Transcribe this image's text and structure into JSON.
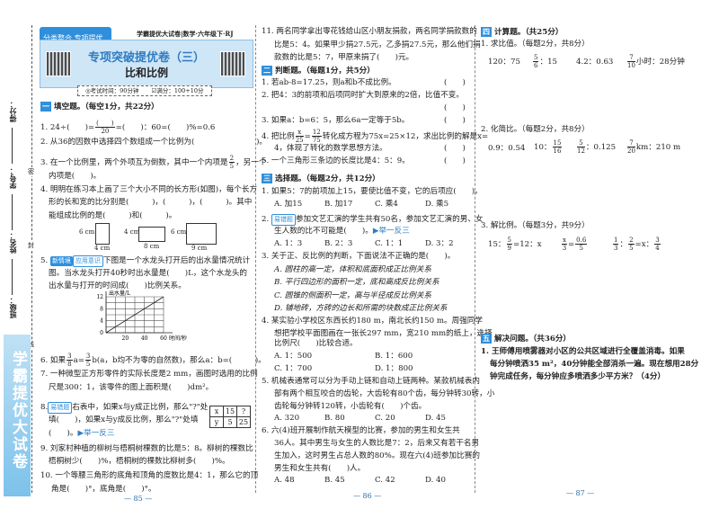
{
  "margin": {
    "labels": [
      "得分：",
      "学号：",
      "姓名：",
      "班级："
    ],
    "seal": [
      "密",
      "封",
      "线"
    ],
    "banner": "学霸提优大试卷"
  },
  "header": {
    "category_tag": "分类整合 专项提优",
    "series": "学霸提优大试卷|数学·六年级下·RJ",
    "title": "专项突破提优卷（三）",
    "subtitle": "比和比例",
    "time": "◎考试时间：90分钟",
    "score": "☑满分：100+10分"
  },
  "section1": {
    "heading_num": "一",
    "heading": "填空题。（每空1分，共22分）",
    "q1": {
      "a": "1. 24÷(　　)=",
      "num": "(　　)",
      "den": "20",
      "b": "=(　　)：60=(　　)%=0.6"
    },
    "q2": "2. 从36的因数中选择四个数组成一个比例为(　　　　　　　　)。",
    "q3": {
      "a": "3. 在一个比例里，两个外项互为倒数，其中一个内项是",
      "num": "2",
      "den": "5",
      "b": "，另一个",
      "c": "内项是(　　)。"
    },
    "q4": [
      "4. 明明在练习本上画了三个大小不同的长方形(如图)，每个长方",
      "形的长和宽的比分别是(　　　)，(　　　)，(　　　)。其中",
      "能组成比例的是(　　　)和(　　　)。"
    ],
    "rects": [
      {
        "h": "6 cm",
        "w": "4 cm"
      },
      {
        "h": "4 cm",
        "w": "8 cm"
      },
      {
        "h": "6 cm",
        "w": "9 cm"
      }
    ],
    "q5": {
      "num": "5.",
      "tag1": "新情境",
      "tag2": "应用意识",
      "lines": [
        "下图是一个水龙头打开后的出水量情况统计",
        "图。当水龙头打开40秒时出水量是(　　)L，这个水龙头的",
        "出水量与打开的时间成(　　)比例关系。"
      ]
    },
    "q6": {
      "a": "6. 如果",
      "n1": "3",
      "d1": "8",
      "b": "a=",
      "n2": "3",
      "d2": "5",
      "c": "b(a，b均不为零的自然数)，那么a：b=(　　　)。"
    },
    "q7": [
      "7. 一种微型正方形零件的实际长度是2 mm，画图时选用的比例",
      "尺是300：1，该零件的图上面积是(　　)dm²。"
    ],
    "q8": {
      "num": "8.",
      "tag": "易错题",
      "lines": [
        "右表中，如果x与y成正比例，那么\"?\"处",
        "填(　　)，如果x与y成反比例，那么\"?\"处填",
        "(　　)。"
      ],
      "link": "▶举一反三"
    },
    "table": {
      "row1": [
        "x",
        "15",
        "?"
      ],
      "row2": [
        "y",
        "5",
        "25"
      ]
    },
    "q9": [
      "9. 刘家村种植的柳树与梧桐树棵数的比是5：8。柳树的棵数比",
      "梧桐树少(　　)%，梧桐树的棵数比柳树多(　　)%。"
    ],
    "q10": [
      "10. 一个等腰三角形的底角和顶角的度数比是4：1，那么它的顶",
      "角是(　　)°，底角是(　　)°。"
    ]
  },
  "chart_data": {
    "type": "line",
    "title": "",
    "xlabel": "时间/秒",
    "ylabel": "出水量/L",
    "xticks": [
      "20",
      "40",
      "60"
    ],
    "yticks": [
      "0",
      "4",
      "8",
      "12"
    ],
    "xlim": [
      0,
      60
    ],
    "ylim": [
      0,
      12
    ],
    "grid": true,
    "series": [
      {
        "name": "出水量",
        "x": [
          0,
          60
        ],
        "y": [
          0,
          12
        ]
      }
    ]
  },
  "middle": {
    "q11": [
      "11. 两名同学拿出零花钱给山区小朋友捐款，两名同学捐款数的",
      "比是5：4。如果甲少捐27.5元，乙多捐27.5元，那么他们捐",
      "款数的比是5：7，甲原来捐了(　　)元。"
    ],
    "section2": {
      "heading_num": "二",
      "heading": "判断题。（每题1分，共5分）",
      "q1": "1. 若ab-8=17.25，则a和b不成比例。",
      "q2": "2. 把4：3的前项和后项同时扩大到原来的2倍，比值不变。",
      "q3": "3. 如果a：b=6：5，那么6a一定等于5b。",
      "q4": {
        "a": "4. 把比例",
        "n1": "x",
        "d1": "25",
        "n2": "12",
        "d2": "75",
        "b": "转化成方程为75x=25×12，求出比例的解是x=",
        "c": "4，体现了转化的数学思想方法。"
      },
      "q5": "5. 一个三角形三条边的长度比是4：5：9。",
      "paren": "(　　)"
    },
    "section3": {
      "heading_num": "三",
      "heading": "选择题。（每题2分，共12分）",
      "q1": "1. 如果5：7的前项加上15，要使比值不变，它的后项应(　　)。",
      "q1_opts": [
        "A. 加15",
        "B. 加17",
        "C. 乘4",
        "D. 乘5"
      ],
      "q2_tag": "易错题",
      "q2": [
        "2. ",
        "参加文艺汇演的学生共有50名，参加文艺汇演的男、女",
        "生人数的比不可能是(　　)。"
      ],
      "q2_link": "▶举一反三",
      "q2_opts": [
        "A. 1：3",
        "B. 2：3",
        "C. 1：1",
        "D. 3：2"
      ],
      "q3": "3. 关于正、反比例的判断，下面说法不正确的是(　　)。",
      "q3_opts": [
        "A. 圆柱的高一定，体积和底面积成正比例关系",
        "B. 平行四边形的面积一定，底和高成反比例关系",
        "C. 圆锥的侧面积一定，高与半径成反比例关系",
        "D. 铺地砖，方砖的边长和所需的块数成正比例关系"
      ],
      "q4": [
        "4. 某实验小学校区东西长约180 m，南北长约150 m。周强同学",
        "想把学校平面图画在一张长297 mm，宽210 mm的纸上，选择",
        "比例尺(　　)比较合适。"
      ],
      "q4_opts": [
        "A. 1：500",
        "B. 1：600",
        "C. 1：700",
        "D. 1：800"
      ],
      "q5": [
        "5. 机械表通常可以分为手动上链和自动上链两种。某款机械表内",
        "部有两个相互咬合的齿轮，大齿轮有80个齿，每分钟转30转，小",
        "齿轮每分钟转120转，小齿轮有(　　)个齿。"
      ],
      "q5_opts": [
        "A. 320",
        "B. 80",
        "C. 20",
        "D. 45"
      ],
      "q6": [
        "6. 六(4)班开展制作航天模型的比赛，参加的男生和女生共",
        "36人。其中男生与女生的人数比是7：2，后来又有若干名男",
        "生加入，这时男生占总人数的80%。现在六(4)班参加比赛的",
        "男生和女生共有(　　)人。"
      ],
      "q6_opts": [
        "A. 48",
        "B. 45",
        "C. 42",
        "D. 40"
      ]
    }
  },
  "right": {
    "section4": {
      "heading_num": "四",
      "heading": "计算题。（共25分）",
      "p1": "1. 求比值。（每题2分，共8分）",
      "p1_items": {
        "a": "120：75",
        "b_n": "5",
        "b_d": "6",
        "b": "：15",
        "c": "4.2：0.63",
        "d_n": "7",
        "d_d": "10",
        "d": "小时：28分钟"
      },
      "p2": "2. 化简比。（每题2分，共8分）",
      "p2_items": {
        "a": "0.9：0.54",
        "b": "10：",
        "b_n": "15",
        "b_d": "16",
        "c_n": "5",
        "c_d": "12",
        "c": "：0.125",
        "d_n": "7",
        "d_d": "20",
        "d": "km：210 m"
      },
      "p3": "3. 解比例。（每题3分，共9分）",
      "p3_items": {
        "a": "15：",
        "a_n": "5",
        "a_d": "9",
        "a2": "=12：x",
        "b_n1": "x",
        "b_d1": "3",
        "b_eq": "=",
        "b_n2": "0.6",
        "b_d2": "5",
        "c_n1": "1",
        "c_d1": "3",
        "c_sep": "：",
        "c_n2": "2",
        "c_d2": "5",
        "c_mid": "=x：",
        "c_n3": "3",
        "c_d3": "4"
      }
    },
    "section5": {
      "heading_num": "五",
      "heading": "解决问题。（共36分）",
      "q1": [
        "1. 王师傅用喷雾器对小区的公共区域进行全覆盖消毒。如果",
        "每分钟喷洒35 m²，40分钟能全部消杀一遍。现在想用28分",
        "钟完成任务，每分钟应多喷洒多少平方米？（4分）"
      ]
    }
  },
  "pages": [
    "— 85 —",
    "— 86 —",
    "— 87 —"
  ]
}
